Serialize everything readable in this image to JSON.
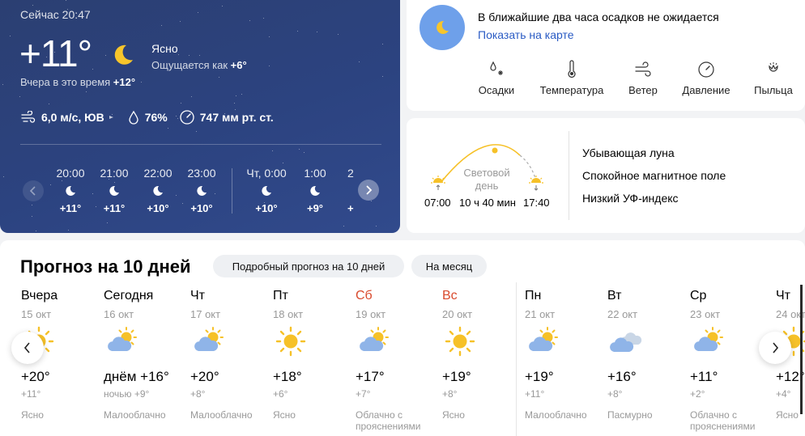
{
  "current": {
    "time_label": "Сейчас 20:47",
    "temperature": "+11°",
    "condition": "Ясно",
    "feels_like_label": "Ощущается как ",
    "feels_like_value": "+6°",
    "yesterday_label": "Вчера в это время ",
    "yesterday_value": "+12°",
    "wind": "6,0 м/с, ЮВ",
    "humidity": "76%",
    "pressure": "747 мм рт. ст.",
    "icons": {
      "condition": "moon-icon",
      "wind": "wind-icon",
      "humidity": "drop-icon",
      "pressure": "pressure-gauge-icon"
    }
  },
  "hourly": [
    {
      "time": "20:00",
      "temp": "+11°",
      "icon": "moon-icon"
    },
    {
      "time": "21:00",
      "temp": "+11°",
      "icon": "moon-icon"
    },
    {
      "time": "22:00",
      "temp": "+10°",
      "icon": "moon-icon"
    },
    {
      "time": "23:00",
      "temp": "+10°",
      "icon": "moon-icon"
    },
    {
      "time": "Чт, 0:00",
      "temp": "+10°",
      "icon": "moon-icon"
    },
    {
      "time": "1:00",
      "temp": "+9°",
      "icon": "moon-icon"
    },
    {
      "time": "2",
      "temp": "+",
      "icon": "moon-icon"
    }
  ],
  "precipitation": {
    "message": "В ближайшие два часа осадков не ожидается",
    "map_link": "Показать на карте",
    "layers": [
      "Осадки",
      "Температура",
      "Ветер",
      "Давление",
      "Пыльца"
    ]
  },
  "sun": {
    "daylight_label_1": "Световой",
    "daylight_label_2": "день",
    "sunrise": "07:00",
    "day_length": "10 ч 40 мин",
    "sunset": "17:40",
    "moon_phase": "Убывающая луна",
    "magnetic_field": "Спокойное магнитное поле",
    "uv_index": "Низкий УФ-индекс"
  },
  "forecast": {
    "title": "Прогноз на 10 дней",
    "detailed_button": "Подробный прогноз на 10 дней",
    "month_button": "На месяц",
    "days": [
      {
        "name": "Вчера",
        "date": "15 окт",
        "icon": "sun-icon",
        "day": "+20°",
        "night": "+11°",
        "cond": "Ясно",
        "weekend": false
      },
      {
        "name": "Сегодня",
        "date": "16 окт",
        "icon": "partly-cloudy-icon",
        "day": "днём +16°",
        "night": "ночью +9°",
        "cond": "Малооблачно",
        "weekend": false
      },
      {
        "name": "Чт",
        "date": "17 окт",
        "icon": "partly-cloudy-icon",
        "day": "+20°",
        "night": "+8°",
        "cond": "Малооблачно",
        "weekend": false
      },
      {
        "name": "Пт",
        "date": "18 окт",
        "icon": "sun-icon",
        "day": "+18°",
        "night": "+6°",
        "cond": "Ясно",
        "weekend": false
      },
      {
        "name": "Сб",
        "date": "19 окт",
        "icon": "partly-cloudy-icon",
        "day": "+17°",
        "night": "+7°",
        "cond": "Облачно с прояснениями",
        "weekend": true
      },
      {
        "name": "Вс",
        "date": "20 окт",
        "icon": "sun-icon",
        "day": "+19°",
        "night": "+8°",
        "cond": "Ясно",
        "weekend": true
      },
      {
        "name": "Пн",
        "date": "21 окт",
        "icon": "partly-cloudy-icon",
        "day": "+19°",
        "night": "+11°",
        "cond": "Малооблачно",
        "weekend": false
      },
      {
        "name": "Вт",
        "date": "22 окт",
        "icon": "cloud-icon",
        "day": "+16°",
        "night": "+8°",
        "cond": "Пасмурно",
        "weekend": false
      },
      {
        "name": "Ср",
        "date": "23 окт",
        "icon": "partly-cloudy-icon",
        "day": "+11°",
        "night": "+2°",
        "cond": "Облачно с прояснениями",
        "weekend": false
      },
      {
        "name": "Чт",
        "date": "24 окт",
        "icon": "sun-icon",
        "day": "+12°",
        "night": "+4°",
        "cond": "Ясно",
        "weekend": false
      }
    ]
  },
  "colors": {
    "night_bg": "#2c4380",
    "weekend": "#d94a2d",
    "link": "#2a5bc4",
    "sun": "#f6c128",
    "precip_circle": "#6ea0ea"
  }
}
